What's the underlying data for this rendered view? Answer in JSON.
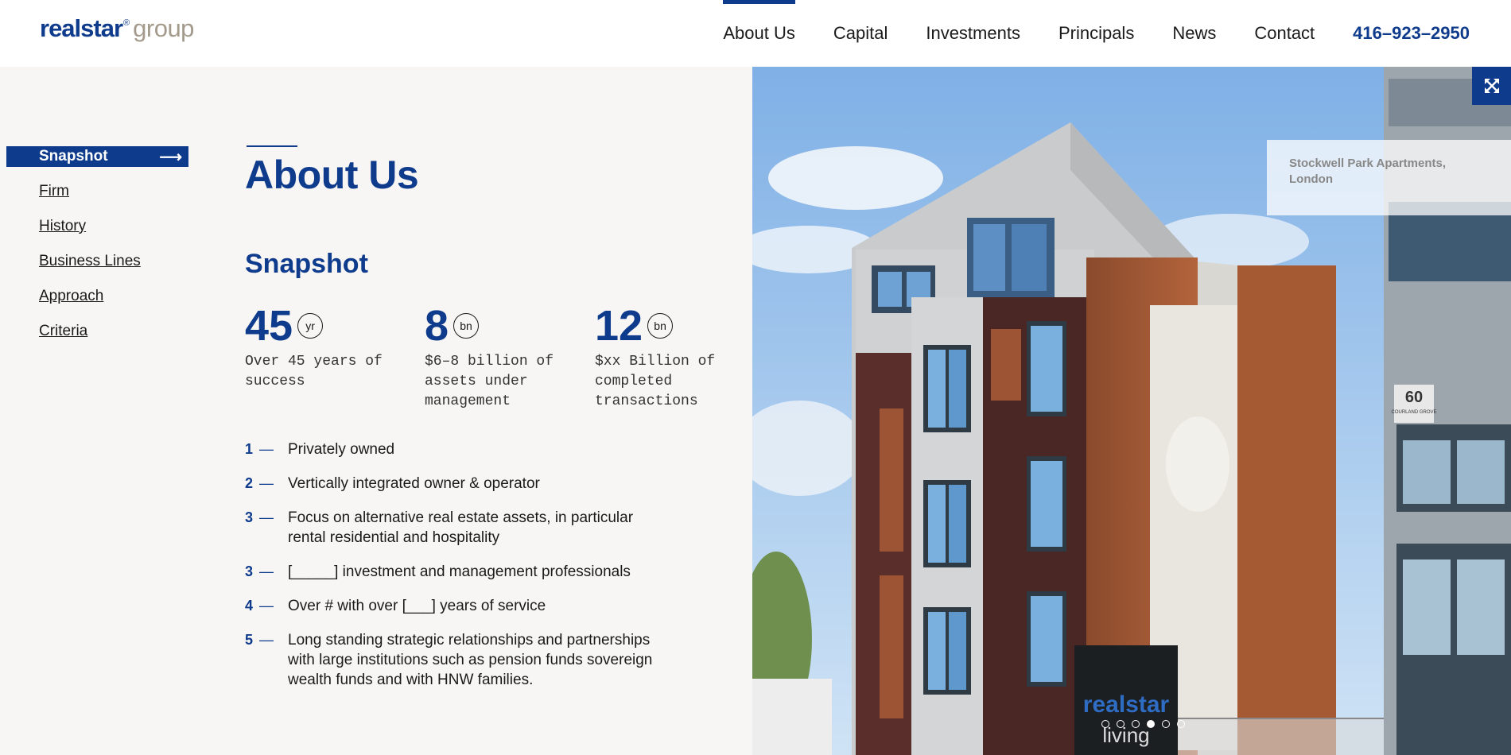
{
  "header": {
    "logo": {
      "main": "realstar",
      "registered": "®",
      "sub": "group"
    },
    "nav": [
      {
        "label": "About Us",
        "active": true
      },
      {
        "label": "Capital",
        "active": false
      },
      {
        "label": "Investments",
        "active": false
      },
      {
        "label": "Principals",
        "active": false
      },
      {
        "label": "News",
        "active": false
      },
      {
        "label": "Contact",
        "active": false
      }
    ],
    "phone": "416–923–2950"
  },
  "sidebar": {
    "items": [
      {
        "label": "Snapshot",
        "active": true,
        "icon": "arrow-right-icon"
      },
      {
        "label": "Firm",
        "active": false
      },
      {
        "label": "History",
        "active": false
      },
      {
        "label": "Business Lines",
        "active": false
      },
      {
        "label": "Approach",
        "active": false
      },
      {
        "label": "Criteria",
        "active": false
      }
    ]
  },
  "main": {
    "title": "About Us",
    "section_title": "Snapshot",
    "stats": [
      {
        "value": "45",
        "unit": "yr",
        "description": "Over 45 years of success"
      },
      {
        "value": "8",
        "unit": "bn",
        "description": "$6–8 billion of assets under management"
      },
      {
        "value": "12",
        "unit": "bn",
        "description": "$xx Billion of completed transactions"
      }
    ],
    "facts": [
      {
        "num": "1",
        "text": "Privately owned"
      },
      {
        "num": "2",
        "text": "Vertically integrated owner & operator"
      },
      {
        "num": "3",
        "text": "Focus on alternative real estate assets, in particular rental residential and hospitality"
      },
      {
        "num": "3",
        "text": "[_____] investment and management professionals"
      },
      {
        "num": "4",
        "text": "Over # with over [___] years of service"
      },
      {
        "num": "5",
        "text": "Long standing strategic relationships and partnerships with large institutions such as pension funds sovereign wealth funds and with HNW families."
      }
    ]
  },
  "hero": {
    "caption": "Stockwell Park Apartments, London",
    "expand_icon": "expand-icon",
    "sign_brand": "realstar",
    "sign_sub": "living",
    "address_number": "60",
    "address_street": "COURLAND GROVE",
    "slides": 6,
    "active_slide": 4
  },
  "colors": {
    "brand": "#0f3b8c",
    "logo_grey": "#a39a8c",
    "background": "#f7f6f5"
  }
}
